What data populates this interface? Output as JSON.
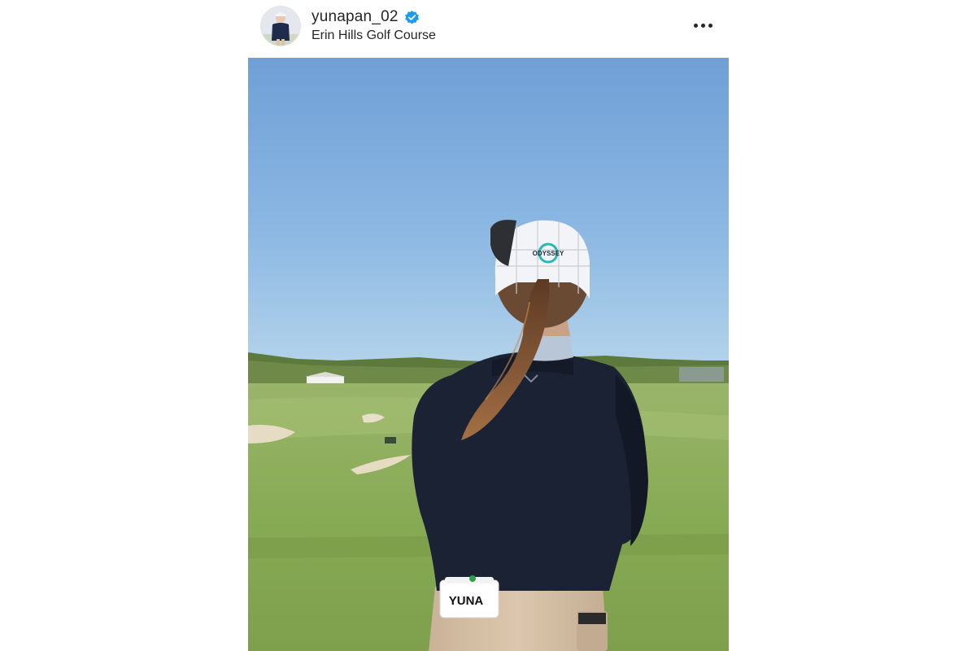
{
  "post": {
    "username": "yunapan_02",
    "verified": true,
    "location": "Erin Hills Golf Course",
    "more_icon": "more-horizontal-icon",
    "avatar_icon": "profile-avatar",
    "image": {
      "description_icon": "photo",
      "hat_logo": "ODYSSEY",
      "card_text": "YUNA"
    }
  },
  "colors": {
    "verified_blue": "#1d9bf0",
    "text": "#262626",
    "sky_top": "#6f9fd6",
    "sky_bottom": "#a9cde8",
    "grass": "#8fae5a",
    "sweater": "#1b2233"
  }
}
